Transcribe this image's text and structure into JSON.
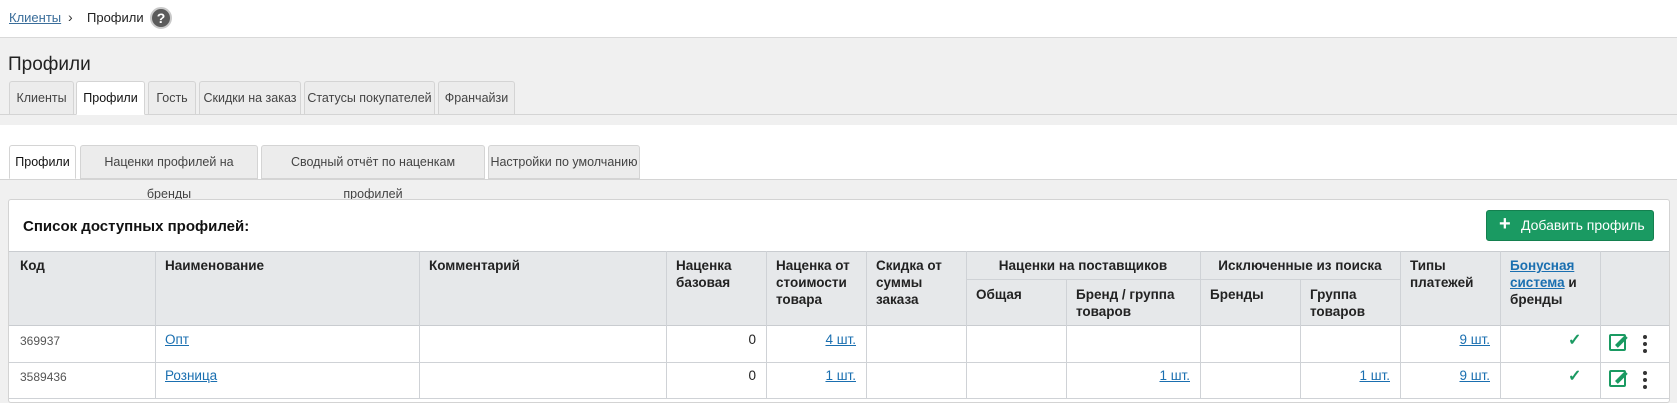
{
  "breadcrumb": {
    "parent": "Клиенты",
    "separator": "›",
    "current": "Профили",
    "help": "?"
  },
  "page": {
    "title": "Профили"
  },
  "main_tabs": [
    "Клиенты",
    "Профили",
    "Гость",
    "Скидки на заказ",
    "Статусы покупателей",
    "Франчайзи"
  ],
  "sub_tabs": [
    "Профили",
    "Наценки профилей на бренды",
    "Сводный отчёт по наценкам профилей",
    "Настройки по умолчанию"
  ],
  "panel": {
    "title": "Список доступных профилей:",
    "add_button": "Добавить профиль",
    "add_icon": "+"
  },
  "table": {
    "headers": {
      "code": "Код",
      "name": "Наименование",
      "comment": "Комментарий",
      "base_markup": "Наценка базовая",
      "cost_markup": "Наценка от стоимости товара",
      "order_discount": "Скидка от суммы заказа",
      "supplier_markups": "Наценки на поставщиков",
      "supplier_general": "Общая",
      "supplier_brand_group": "Бренд / группа товаров",
      "excluded": "Исключенные из поиска",
      "excluded_brands": "Бренды",
      "excluded_groups": "Группа товаров",
      "payment_types": "Типы платежей",
      "bonus_link": "Бонусная система",
      "bonus_suffix": "и бренды"
    },
    "rows": [
      {
        "code": "369937",
        "name": "Опт",
        "comment": "",
        "base_markup": "0",
        "cost_markup": "4 шт.",
        "order_discount": "",
        "supplier_general": "",
        "supplier_brand_group": "",
        "excluded_brands": "",
        "excluded_groups": "",
        "payment_types": "9 шт.",
        "bonus": "✓"
      },
      {
        "code": "3589436",
        "name": "Розница",
        "comment": "",
        "base_markup": "0",
        "cost_markup": "1 шт.",
        "order_discount": "",
        "supplier_general": "",
        "supplier_brand_group": "1 шт.",
        "excluded_brands": "",
        "excluded_groups": "1 шт.",
        "payment_types": "9 шт.",
        "bonus": "✓"
      }
    ]
  },
  "icons": {
    "edit": "edit-icon",
    "more": "more-vertical-icon",
    "check": "check-icon"
  },
  "colors": {
    "accent_green": "#1a9a62",
    "link_blue": "#1a6fb0"
  }
}
